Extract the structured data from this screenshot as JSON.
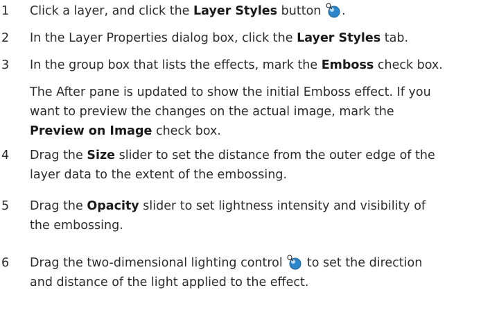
{
  "steps": [
    {
      "num": "1",
      "t1": "Click a layer, and click the ",
      "b1": "Layer Styles",
      "t2": " button ",
      "t3": "."
    },
    {
      "num": "2",
      "t1": "In the Layer Properties dialog box, click the ",
      "b1": "Layer Styles",
      "t2": " tab."
    },
    {
      "num": "3",
      "t1": "In the group box that lists the effects, mark the ",
      "b1": "Emboss",
      "t2": " check box.",
      "p_line1": "The After pane is updated to show the initial Emboss effect. If you",
      "p_line2": "want to preview the changes on the actual image, mark the",
      "p_bold": "Preview on Image",
      "p_end": " check box."
    },
    {
      "num": "4",
      "t1": "Drag the ",
      "b1": "Size",
      "t2": " slider to set the distance from the outer edge of the",
      "line2": "layer data to the extent of the embossing."
    },
    {
      "num": "5",
      "t1": "Drag the ",
      "b1": "Opacity",
      "t2": " slider to set lightness intensity and visibility of",
      "line2": "the embossing."
    },
    {
      "num": "6",
      "t1": "Drag the two-dimensional lighting control ",
      "t2": " to set the direction",
      "line2": "and distance of the light applied to the effect."
    }
  ],
  "icons": {
    "layer_styles": "layer-styles-icon",
    "lighting_control": "lighting-control-icon"
  },
  "colors": {
    "text": "#2b2b2b",
    "icon_blue": "#2d86c9"
  }
}
